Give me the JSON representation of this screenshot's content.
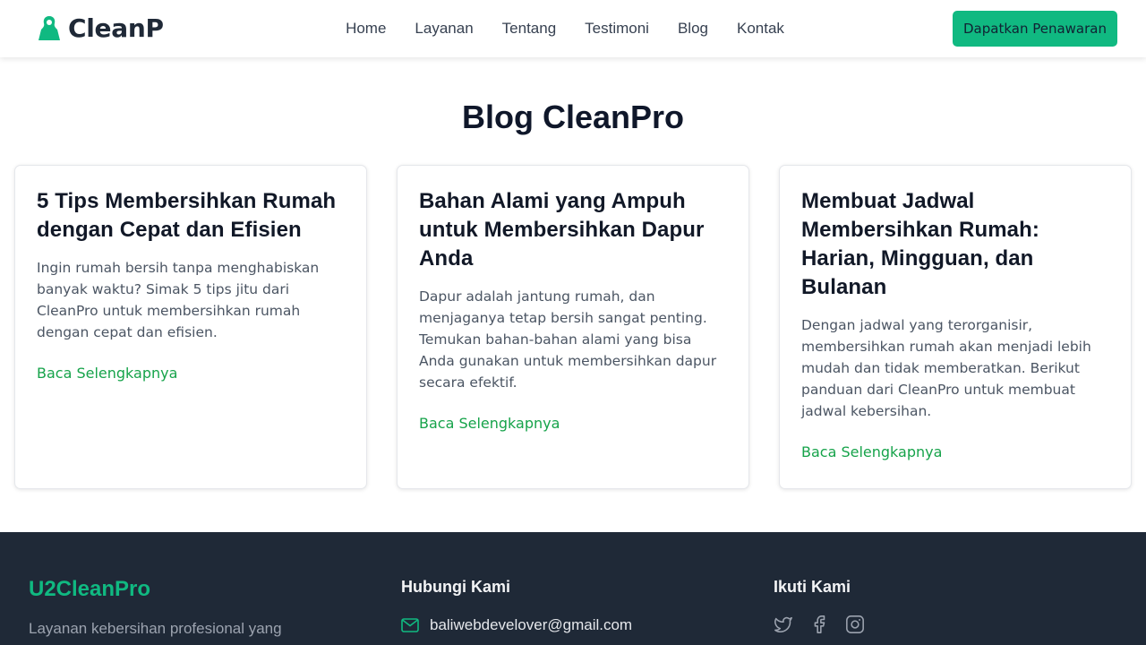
{
  "header": {
    "brand": "CleanPro",
    "nav": [
      "Home",
      "Layanan",
      "Tentang",
      "Testimoni",
      "Blog",
      "Kontak"
    ],
    "cta": "Dapatkan Penawaran"
  },
  "blog": {
    "title": "Blog CleanPro",
    "posts": [
      {
        "title": "5 Tips Membersihkan Rumah dengan Cepat dan Efisien",
        "excerpt": "Ingin rumah bersih tanpa menghabiskan banyak waktu? Simak 5 tips jitu dari CleanPro untuk membersihkan rumah dengan cepat dan efisien.",
        "link": "Baca Selengkapnya"
      },
      {
        "title": "Bahan Alami yang Ampuh untuk Membersihkan Dapur Anda",
        "excerpt": "Dapur adalah jantung rumah, dan menjaganya tetap bersih sangat penting. Temukan bahan-bahan alami yang bisa Anda gunakan untuk membersihkan dapur secara efektif.",
        "link": "Baca Selengkapnya"
      },
      {
        "title": "Membuat Jadwal Membersihkan Rumah: Harian, Mingguan, dan Bulanan",
        "excerpt": "Dengan jadwal yang terorganisir, membersihkan rumah akan menjadi lebih mudah dan tidak memberatkan. Berikut panduan dari CleanPro untuk membuat jadwal kebersihan.",
        "link": "Baca Selengkapnya"
      }
    ]
  },
  "footer": {
    "brand": "U2CleanPro",
    "description": "Layanan kebersihan profesional yang",
    "contact_heading": "Hubungi Kami",
    "email": "baliwebdevelover@gmail.com",
    "social_heading": "Ikuti Kami",
    "socials": [
      "twitter-icon",
      "facebook-icon",
      "instagram-icon"
    ]
  },
  "colors": {
    "accent": "#10b981",
    "link": "#16a34a",
    "footer_bg": "#1f2937"
  }
}
